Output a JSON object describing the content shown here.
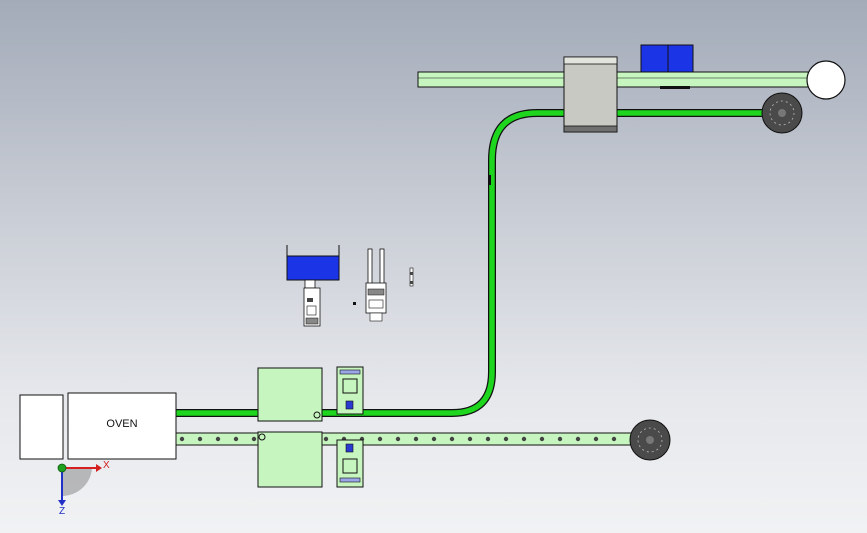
{
  "colors": {
    "belt_green": "#1dd61d",
    "pale_green": "#c6f5c0",
    "blue_block": "#1a34e6",
    "grey_block": "#c9c9c4",
    "wheel_dark": "#4a4a4a",
    "outline": "#111111",
    "axis_x": "#d42020",
    "axis_y": "#1ea01e",
    "axis_z": "#2030c8"
  },
  "oven": {
    "label": "OVEN"
  },
  "triad": {
    "x_label": "X",
    "z_label": "Z"
  },
  "icons": [
    "triad-icon",
    "wheel-icon",
    "pulley-icon"
  ]
}
